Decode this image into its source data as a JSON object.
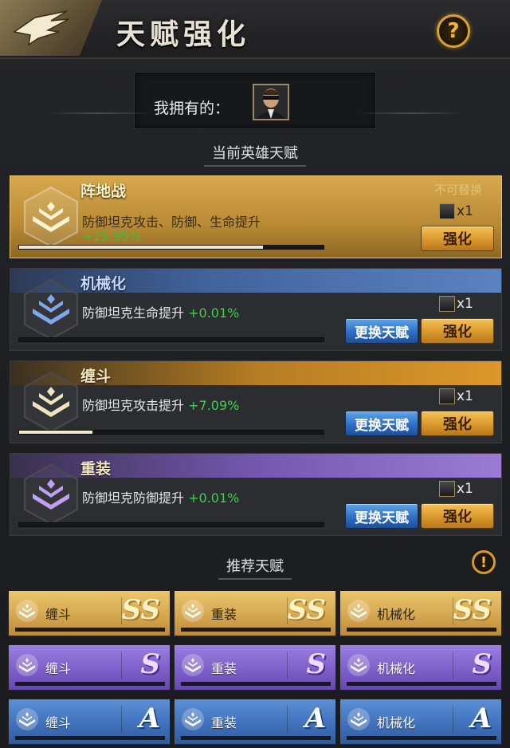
{
  "header": {
    "title": "天赋强化",
    "help_label": "?"
  },
  "owned": {
    "label": "我拥有的："
  },
  "current_section_title": "当前英雄天赋",
  "talents": [
    {
      "name": "阵地战",
      "desc": "防御坦克攻击、防御、生命提升",
      "value": "+15.95%",
      "lock_text": "不可替换",
      "cost": "x1",
      "strengthen": "强化",
      "progress": 0.8
    },
    {
      "name": "机械化",
      "desc": "防御坦克生命提升",
      "value": "+0.01%",
      "cost": "x1",
      "swap": "更换天赋",
      "strengthen": "强化",
      "progress": 0.0
    },
    {
      "name": "缠斗",
      "desc": "防御坦克攻击提升",
      "value": "+7.09%",
      "cost": "x1",
      "swap": "更换天赋",
      "strengthen": "强化",
      "progress": 0.24
    },
    {
      "name": "重装",
      "desc": "防御坦克防御提升",
      "value": "+0.01%",
      "cost": "x1",
      "swap": "更换天赋",
      "strengthen": "强化",
      "progress": 0.0
    }
  ],
  "recommended_section_title": "推荐天赋",
  "warn_label": "!",
  "recommended": [
    [
      {
        "name": "缠斗",
        "grade": "SS"
      },
      {
        "name": "重装",
        "grade": "SS"
      },
      {
        "name": "机械化",
        "grade": "SS"
      }
    ],
    [
      {
        "name": "缠斗",
        "grade": "S"
      },
      {
        "name": "重装",
        "grade": "S"
      },
      {
        "name": "机械化",
        "grade": "S"
      }
    ],
    [
      {
        "name": "缠斗",
        "grade": "A"
      },
      {
        "name": "重装",
        "grade": "A"
      },
      {
        "name": "机械化",
        "grade": "A"
      }
    ]
  ],
  "colors": {
    "gold": "#d7a84b",
    "blue": "#41639c",
    "orange": "#dd972b",
    "purple": "#7458b0",
    "value_green": "#3fd04b"
  }
}
